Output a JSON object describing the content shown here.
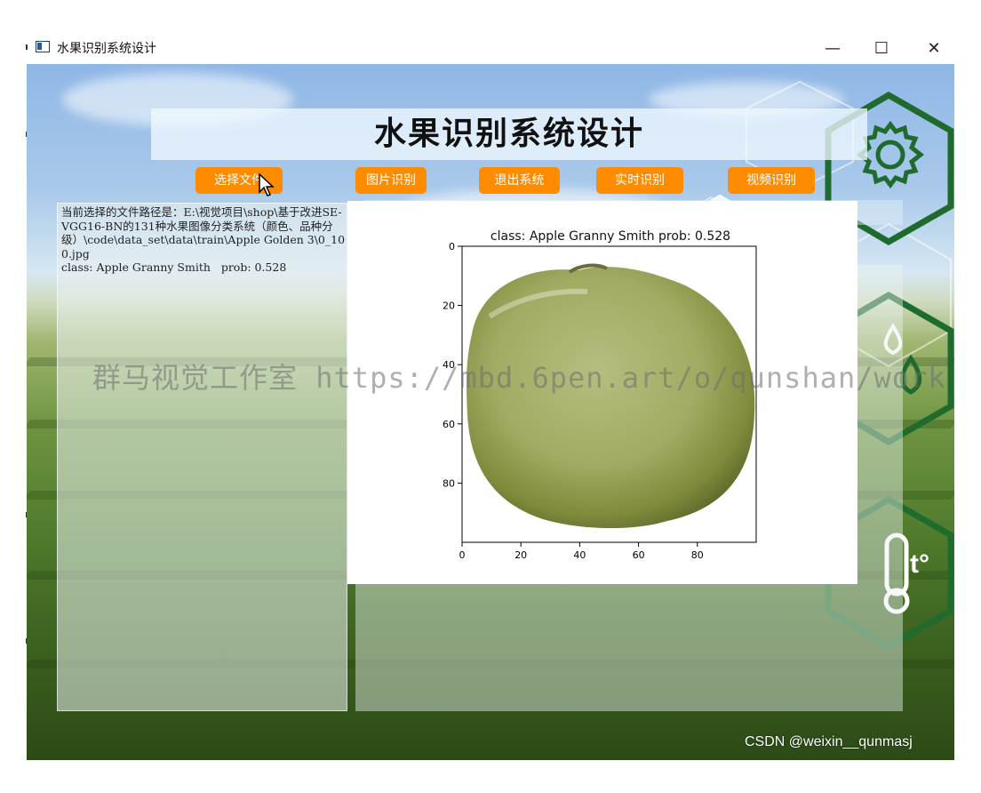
{
  "window": {
    "title": "水果识别系统设计",
    "minimize_glyph": "—",
    "maximize_glyph": "☐",
    "close_glyph": "✕"
  },
  "header": {
    "title": "水果识别系统设计"
  },
  "toolbar": {
    "select_file_label": "选择文件",
    "image_recognize_label": "图片识别",
    "exit_label": "退出系统",
    "realtime_label": "实时识别",
    "video_label": "视频识别",
    "button_color": "#ff8c00"
  },
  "result_panel": {
    "path_text": "当前选择的文件路径是：E:\\视觉项目\\shop\\基于改进SE-VGG16-BN的131种水果图像分类系统（颜色、品种分级）\\code\\data_set\\data\\train\\Apple Golden 3\\0_100.jpg\nclass: Apple Granny Smith   prob: 0.528"
  },
  "chart_data": {
    "type": "image",
    "title": "class: Apple Granny Smith   prob: 0.528",
    "xticks": [
      "0",
      "20",
      "40",
      "60",
      "80"
    ],
    "yticks": [
      "0",
      "20",
      "40",
      "60",
      "80"
    ],
    "xlim": [
      0,
      100
    ],
    "ylim": [
      100,
      0
    ]
  },
  "overlay": {
    "watermark": "群马视觉工作室 https://mbd.6pen.art/o/qunshan/work",
    "csdn_credit": "CSDN @weixin__qunmasj"
  },
  "decor": {
    "hex_color": "#1f6b2e",
    "icons": [
      "gear-icon",
      "plant-icon",
      "water-drop-icon",
      "thermometer-icon"
    ]
  }
}
